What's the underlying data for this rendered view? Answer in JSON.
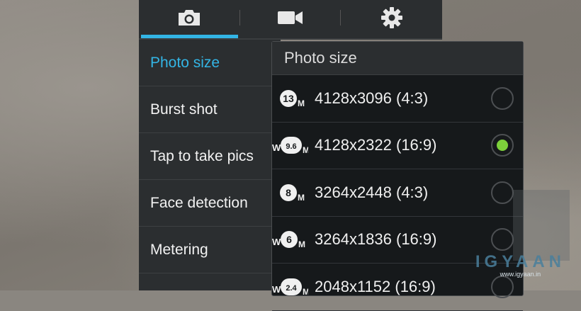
{
  "tabs": [
    {
      "icon": "camera-icon"
    },
    {
      "icon": "video-camera-icon"
    },
    {
      "icon": "gear-icon"
    }
  ],
  "menu": {
    "items": [
      {
        "label": "Photo size",
        "selected": true
      },
      {
        "label": "Burst shot"
      },
      {
        "label": "Tap to take pics"
      },
      {
        "label": "Face detection"
      },
      {
        "label": "Metering"
      }
    ]
  },
  "popup": {
    "title": "Photo size",
    "options": [
      {
        "badge": "13",
        "wide": false,
        "label": "4128x3096 (4:3)",
        "checked": false
      },
      {
        "badge": "9.6",
        "wide": true,
        "label": "4128x2322 (16:9)",
        "checked": true
      },
      {
        "badge": "8",
        "wide": false,
        "label": "3264x2448 (4:3)",
        "checked": false
      },
      {
        "badge": "6",
        "wide": true,
        "label": "3264x1836 (16:9)",
        "checked": false
      },
      {
        "badge": "2.4",
        "wide": true,
        "label": "2048x1152 (16:9)",
        "checked": false
      }
    ]
  },
  "watermark": {
    "logo": "IGYAAN",
    "url": "www.igyaan.in"
  },
  "colors": {
    "accent": "#33b5e5",
    "radio_checked": "#7dd13b",
    "panel": "#2b2e30"
  }
}
